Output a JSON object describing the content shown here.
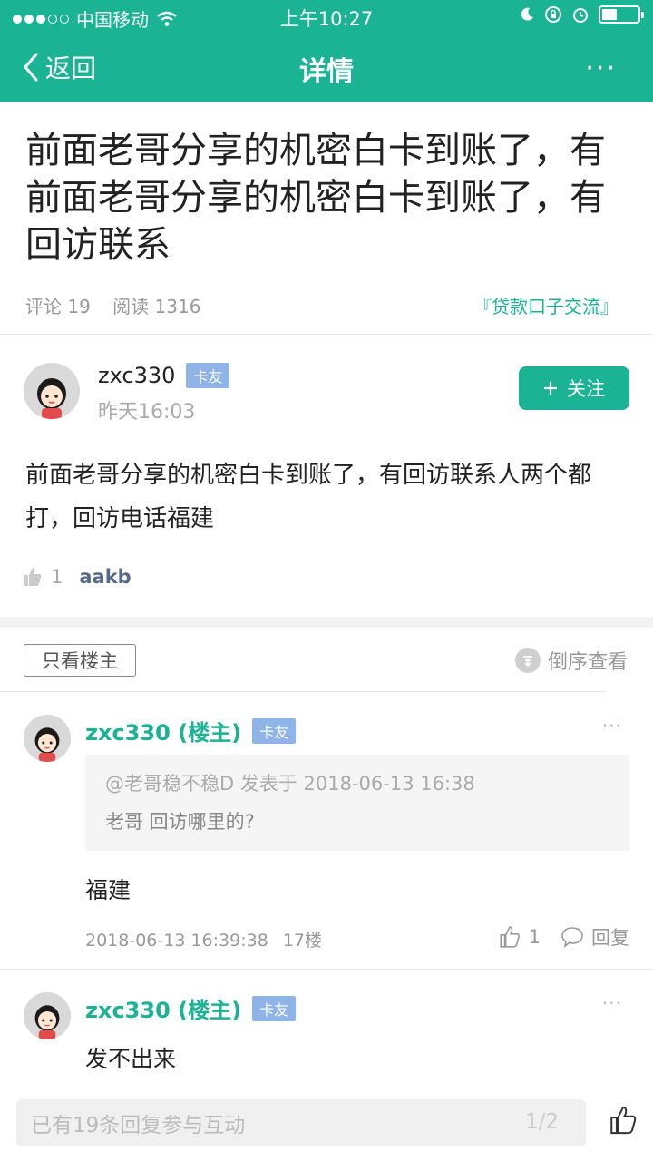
{
  "status_bar": {
    "carrier": "中国移动",
    "time": "上午10:27"
  },
  "nav": {
    "back_label": "返回",
    "title": "详情",
    "more": "···"
  },
  "post": {
    "title": "前面老哥分享的机密白卡到账了，有前面老哥分享的机密白卡到账了，有回访联系",
    "comments": "评论 19",
    "reads": "阅读 1316",
    "forum_tag": "『贷款口子交流』",
    "author": "zxc330",
    "author_badge": "卡友",
    "time": "昨天16:03",
    "follow_label": "关注",
    "body": "前面老哥分享的机密白卡到账了，有回访联系人两个都打，回访电话福建",
    "like_count": "1",
    "liked_by": "aakb"
  },
  "filters": {
    "only_owner": "只看楼主",
    "reverse_order": "倒序查看"
  },
  "replies": [
    {
      "name": "zxc330 (楼主)",
      "badge": "卡友",
      "quote_head": "@老哥稳不稳D 发表于 2018-06-13 16:38",
      "quote_text": "老哥 回访哪里的?",
      "text": "福建",
      "datetime": "2018-06-13 16:39:38",
      "floor": "17楼",
      "likes": "1",
      "reply_label": "回复"
    },
    {
      "name": "zxc330 (楼主)",
      "badge": "卡友",
      "text": "发不出来"
    }
  ],
  "bottom": {
    "placeholder": "已有19条回复参与互动",
    "page": "1/2"
  }
}
